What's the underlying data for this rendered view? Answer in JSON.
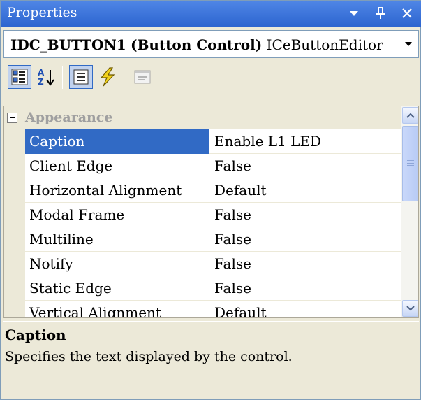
{
  "window": {
    "title": "Properties",
    "icons": {
      "dropdown": "dropdown-arrow-icon",
      "pin": "pin-icon",
      "close": "close-icon"
    }
  },
  "object_selector": {
    "name": "IDC_BUTTON1",
    "type": "(Button Control)",
    "editor": "ICeButtonEditor"
  },
  "toolbar": {
    "buttons": [
      {
        "name": "categorized-icon",
        "pressed": true
      },
      {
        "name": "alphabetical-icon",
        "pressed": false
      },
      {
        "name": "properties-icon",
        "pressed": true
      },
      {
        "name": "events-icon",
        "pressed": false
      },
      {
        "name": "property-pages-icon",
        "pressed": false,
        "disabled": true
      }
    ]
  },
  "grid": {
    "category": "Appearance",
    "rows": [
      {
        "name": "Caption",
        "value": "Enable L1 LED",
        "selected": true
      },
      {
        "name": "Client Edge",
        "value": "False"
      },
      {
        "name": "Horizontal Alignment",
        "value": "Default"
      },
      {
        "name": "Modal Frame",
        "value": "False"
      },
      {
        "name": "Multiline",
        "value": "False"
      },
      {
        "name": "Notify",
        "value": "False"
      },
      {
        "name": "Static Edge",
        "value": "False"
      },
      {
        "name": "Vertical Alignment",
        "value": "Default"
      }
    ]
  },
  "description": {
    "title": "Caption",
    "text": "Specifies the text displayed by the control."
  },
  "colors": {
    "titlebar": "#2c64cf",
    "selection": "#316ac5",
    "panel": "#ece9d8",
    "category_text": "#a0a0a0"
  }
}
